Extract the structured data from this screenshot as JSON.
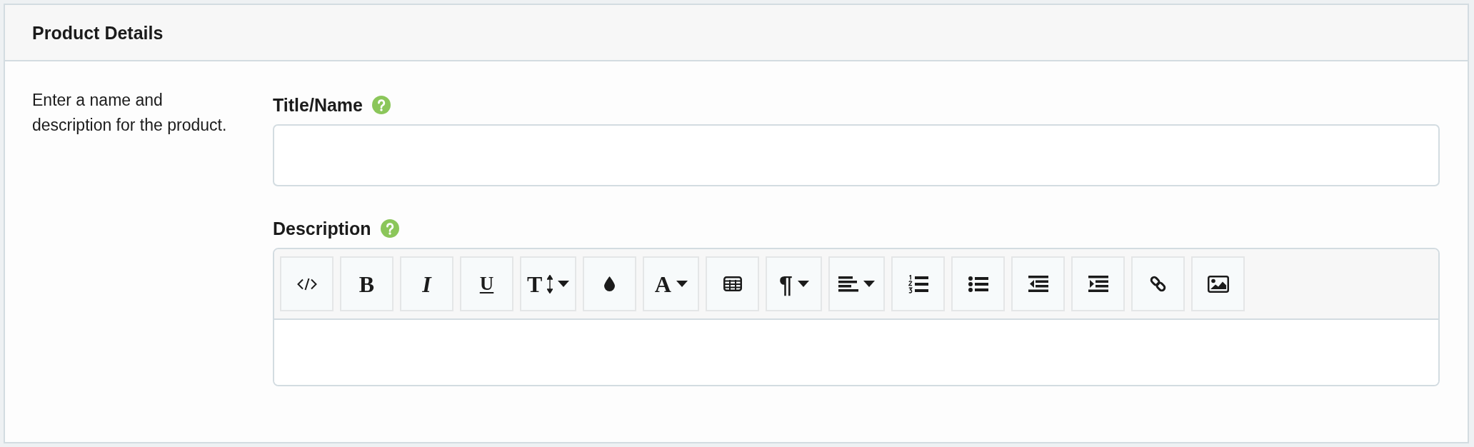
{
  "panel": {
    "title": "Product Details"
  },
  "intro": "Enter a name and description for the product.",
  "fields": [
    {
      "kind": "text",
      "label": "Title/Name",
      "help": true
    },
    {
      "kind": "rich_text",
      "label": "Description",
      "help": true,
      "toolbar": [
        {
          "kind": "code",
          "dropdown": false
        },
        {
          "kind": "bold",
          "glyph": "B",
          "dropdown": false
        },
        {
          "kind": "italic",
          "glyph": "I",
          "dropdown": false
        },
        {
          "kind": "underline",
          "glyph": "U",
          "dropdown": false
        },
        {
          "kind": "font_size",
          "glyph": "T",
          "dropdown": true
        },
        {
          "kind": "color",
          "dropdown": false
        },
        {
          "kind": "font",
          "glyph": "A",
          "dropdown": true
        },
        {
          "kind": "table",
          "dropdown": false
        },
        {
          "kind": "paragraph",
          "glyph": "¶",
          "dropdown": true
        },
        {
          "kind": "align",
          "dropdown": true
        },
        {
          "kind": "ordered_list",
          "dropdown": false
        },
        {
          "kind": "unordered_list",
          "dropdown": false
        },
        {
          "kind": "outdent",
          "dropdown": false
        },
        {
          "kind": "indent",
          "dropdown": false
        },
        {
          "kind": "link",
          "dropdown": false
        },
        {
          "kind": "image",
          "dropdown": false
        }
      ]
    }
  ]
}
